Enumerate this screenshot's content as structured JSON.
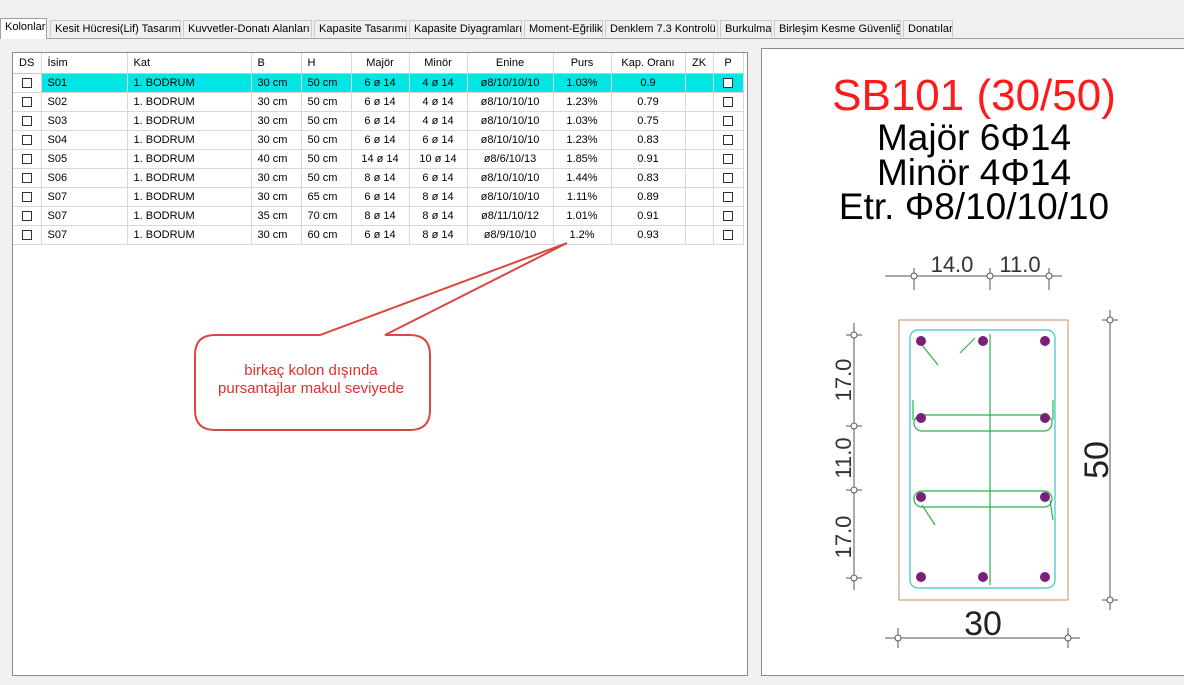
{
  "tabs": [
    "Kolonlar",
    "Kesit Hücresi(Lif) Tasarımı",
    "Kuvvetler-Donatı Alanları",
    "Kapasite Tasarımı",
    "Kapasite Diyagramları",
    "Moment-Eğrilik",
    "Denklem 7.3 Kontrolü",
    "Burkulma",
    "Birleşim Kesme Güvenliği",
    "Donatılar"
  ],
  "columns": [
    "DS",
    "İsim",
    "Kat",
    "B",
    "H",
    "Majör",
    "Minör",
    "Enine",
    "Purs",
    "Kap. Oranı",
    "ZK",
    "P"
  ],
  "rows": [
    [
      "S01",
      "1. BODRUM",
      "30 cm",
      "50 cm",
      "6 ø 14",
      "4 ø 14",
      "ø8/10/10/10",
      "1.03%",
      "0.9"
    ],
    [
      "S02",
      "1. BODRUM",
      "30 cm",
      "50 cm",
      "6 ø 14",
      "4 ø 14",
      "ø8/10/10/10",
      "1.23%",
      "0.79"
    ],
    [
      "S03",
      "1. BODRUM",
      "30 cm",
      "50 cm",
      "6 ø 14",
      "4 ø 14",
      "ø8/10/10/10",
      "1.03%",
      "0.75"
    ],
    [
      "S04",
      "1. BODRUM",
      "30 cm",
      "50 cm",
      "6 ø 14",
      "6 ø 14",
      "ø8/10/10/10",
      "1.23%",
      "0.83"
    ],
    [
      "S05",
      "1. BODRUM",
      "40 cm",
      "50 cm",
      "14 ø 14",
      "10 ø 14",
      "ø8/6/10/13",
      "1.85%",
      "0.91"
    ],
    [
      "S06",
      "1. BODRUM",
      "30 cm",
      "50 cm",
      "8 ø 14",
      "6 ø 14",
      "ø8/10/10/10",
      "1.44%",
      "0.83"
    ],
    [
      "S07",
      "1. BODRUM",
      "30 cm",
      "65 cm",
      "6 ø 14",
      "8 ø 14",
      "ø8/10/10/10",
      "1.11%",
      "0.89"
    ],
    [
      "S07",
      "1. BODRUM",
      "35 cm",
      "70 cm",
      "8 ø 14",
      "8 ø 14",
      "ø8/11/10/12",
      "1.01%",
      "0.91"
    ],
    [
      "S07",
      "1. BODRUM",
      "30 cm",
      "60 cm",
      "6 ø 14",
      "8 ø 14",
      "ø8/9/10/10",
      "1.2%",
      "0.93"
    ]
  ],
  "callout": {
    "line1": "birkaç kolon dışında",
    "line2": "pursantajlar makul  seviyede"
  },
  "section": {
    "title": "SB101 (30/50)",
    "major": "Majör 6Φ14",
    "minor": "Minör 4Φ14",
    "stirrup": "Etr. Φ8/10/10/10",
    "top_dim_1": "14.0",
    "top_dim_2": "11.0",
    "left_dim_1": "17.0",
    "left_dim_2": "11.0",
    "left_dim_3": "17.0",
    "height_label": "50",
    "width_label": "30"
  },
  "colors": {
    "selection": "#00e5e5",
    "title_red": "#ff1a1a",
    "bar": "#7a1f7a",
    "stirrup_green": "#2bb24c",
    "tie_cyan": "#37c6c6",
    "concrete": "#c8a07a"
  }
}
